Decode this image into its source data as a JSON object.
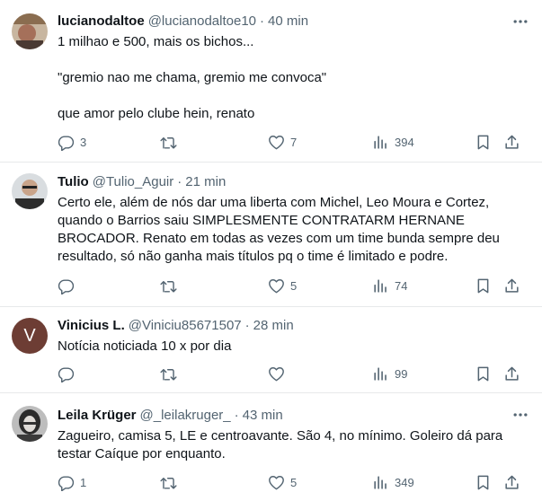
{
  "tweets": [
    {
      "name": "lucianodaltoe",
      "handle": "@lucianodaltoe10",
      "time": "40 min",
      "text": "1 milhao e 500, mais os bichos...\n\n\"gremio nao me chama, gremio me convoca\"\n\nque amor pelo clube hein, renato",
      "replies": "3",
      "retweets": "",
      "likes": "7",
      "views": "394"
    },
    {
      "name": "Tulio",
      "handle": "@Tulio_Aguir",
      "time": "21 min",
      "text": "Certo ele, além de nós dar uma liberta com Michel, Leo Moura e Cortez, quando o Barrios saiu SIMPLESMENTE CONTRATARM HERNANE BROCADOR. Renato em todas as vezes com um time bunda sempre deu resultado, só não ganha mais títulos pq o time é limitado e podre.",
      "replies": "",
      "retweets": "",
      "likes": "5",
      "views": "74"
    },
    {
      "name": "Vinicius L.",
      "handle": "@Viniciu85671507",
      "time": "28 min",
      "text": "Notícia noticiada 10 x por dia",
      "replies": "",
      "retweets": "",
      "likes": "",
      "views": "99",
      "avatar_letter": "V"
    },
    {
      "name": "Leila Krüger",
      "handle": "@_leilakruger_",
      "time": "43 min",
      "text": "Zagueiro, camisa 5, LE e centroavante. São 4, no mínimo. Goleiro dá para testar Caíque por enquanto.",
      "replies": "1",
      "retweets": "",
      "likes": "5",
      "views": "349"
    }
  ],
  "colors": {
    "text": "#0f1419",
    "secondary": "#536471",
    "divider": "#e7e9ea",
    "vinicius_avatar": "#6d3d34"
  },
  "icons": [
    "more-icon",
    "reply-icon",
    "retweet-icon",
    "like-icon",
    "views-icon",
    "bookmark-icon",
    "share-icon"
  ]
}
